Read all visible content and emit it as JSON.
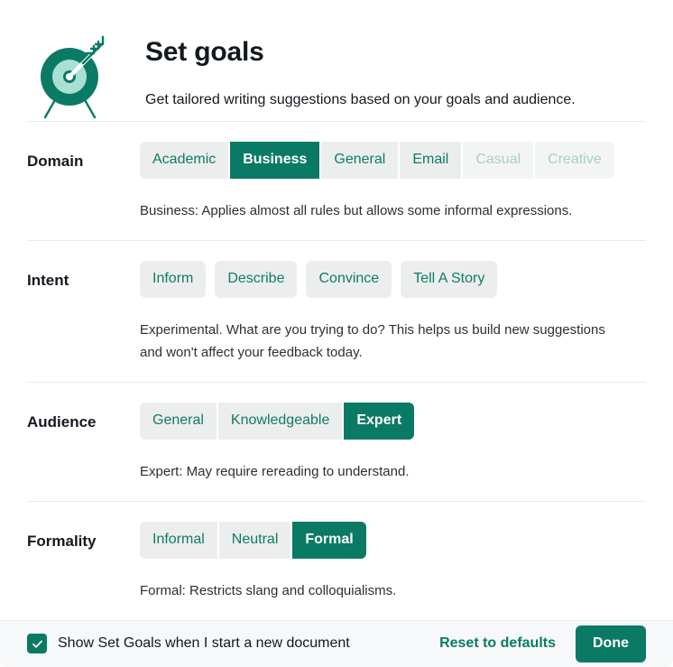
{
  "header": {
    "icon_name": "target-with-arrow-icon",
    "title": "Set goals",
    "subtitle": "Get tailored writing suggestions based on your goals and audience."
  },
  "colors": {
    "accent": "#0b7a64",
    "chip_bg": "#eceeee",
    "chip_text": "#0f7c66",
    "chip_disabled_bg": "#f3f5f5",
    "chip_disabled_text": "#a9cfc7",
    "title_text": "#14181f",
    "footer_bg": "#f7f8fa",
    "divider": "#e8eaed",
    "icon_dark": "#0b7a64",
    "icon_light": "#a8e0d4"
  },
  "sections": [
    {
      "label": "Domain",
      "style": "segmented",
      "options": [
        {
          "label": "Academic",
          "state": "normal"
        },
        {
          "label": "Business",
          "state": "selected"
        },
        {
          "label": "General",
          "state": "normal"
        },
        {
          "label": "Email",
          "state": "normal"
        },
        {
          "label": "Casual",
          "state": "disabled"
        },
        {
          "label": "Creative",
          "state": "disabled"
        }
      ],
      "description": "Business: Applies almost all rules but allows some informal expressions."
    },
    {
      "label": "Intent",
      "style": "spaced",
      "options": [
        {
          "label": "Inform",
          "state": "normal"
        },
        {
          "label": "Describe",
          "state": "normal"
        },
        {
          "label": "Convince",
          "state": "normal"
        },
        {
          "label": "Tell A Story",
          "state": "normal"
        }
      ],
      "description": "Experimental. What are you trying to do? This helps us build new suggestions and won't affect your feedback today."
    },
    {
      "label": "Audience",
      "style": "segmented",
      "options": [
        {
          "label": "General",
          "state": "normal"
        },
        {
          "label": "Knowledgeable",
          "state": "normal"
        },
        {
          "label": "Expert",
          "state": "selected"
        }
      ],
      "description": "Expert: May require rereading to understand."
    },
    {
      "label": "Formality",
      "style": "segmented",
      "options": [
        {
          "label": "Informal",
          "state": "normal"
        },
        {
          "label": "Neutral",
          "state": "normal"
        },
        {
          "label": "Formal",
          "state": "selected"
        }
      ],
      "description": "Formal: Restricts slang and colloquialisms."
    }
  ],
  "footer": {
    "checkbox_checked": true,
    "checkbox_icon": "checkmark-icon",
    "checkbox_label": "Show Set Goals when I start a new document",
    "reset_label": "Reset to defaults",
    "done_label": "Done"
  }
}
